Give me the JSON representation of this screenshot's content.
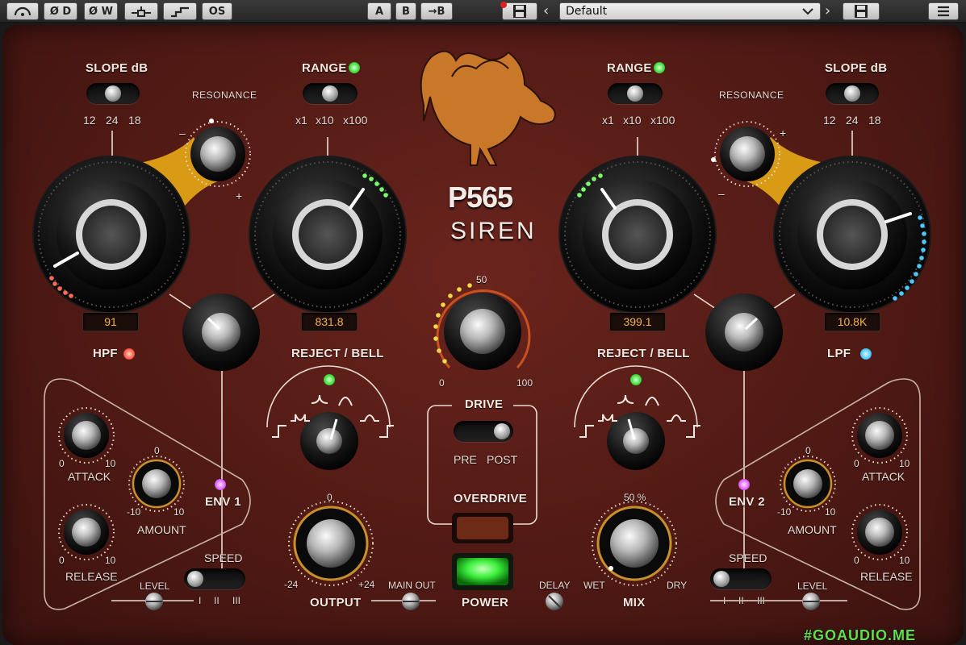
{
  "toolbar": {
    "buttons": [
      "Ø D",
      "Ø W",
      "OS"
    ],
    "ab": {
      "a": "A",
      "b": "B",
      "copy": "→B"
    },
    "preset_name": "Default"
  },
  "brand": {
    "model": "P565",
    "name": "SIREN"
  },
  "left": {
    "slope_title": "SLOPE dB",
    "slope_opts": [
      "12",
      "24",
      "18"
    ],
    "resonance": "RESONANCE",
    "res_minus": "–",
    "res_plus": "+",
    "range_title": "RANGE",
    "range_opts": [
      "x1",
      "x10",
      "x100"
    ],
    "hpf_value": "91",
    "bell_value": "831.8",
    "filter_label": "HPF",
    "reject_bell": "REJECT / BELL",
    "env_label": "ENV 1",
    "attack": "ATTACK",
    "release": "RELEASE",
    "amount": "AMOUNT",
    "speed": "SPEED",
    "level": "LEVEL",
    "speed_opts": [
      "I",
      "II",
      "III"
    ],
    "scale_0": "0",
    "scale_10": "10",
    "scale_m10": "-10"
  },
  "right": {
    "slope_title": "SLOPE dB",
    "slope_opts": [
      "12",
      "24",
      "18"
    ],
    "resonance": "RESONANCE",
    "res_minus": "–",
    "res_plus": "+",
    "range_title": "RANGE",
    "range_opts": [
      "x1",
      "x10",
      "x100"
    ],
    "bell_value": "399.1",
    "lpf_value": "10.8K",
    "filter_label": "LPF",
    "reject_bell": "REJECT / BELL",
    "env_label": "ENV 2",
    "attack": "ATTACK",
    "release": "RELEASE",
    "amount": "AMOUNT",
    "speed": "SPEED",
    "level": "LEVEL",
    "speed_opts": [
      "I",
      "II",
      "III"
    ],
    "scale_0": "0",
    "scale_10": "10",
    "scale_m10": "-10"
  },
  "center": {
    "drive_50": "50",
    "drive_0": "0",
    "drive_100": "100",
    "drive": "DRIVE",
    "pre": "PRE",
    "post": "POST",
    "overdrive": "OVERDRIVE",
    "power": "POWER",
    "output": "OUTPUT",
    "out_0": "0",
    "out_min": "-24",
    "out_max": "+24",
    "main_out": "MAIN OUT",
    "delay": "DELAY",
    "wet": "WET",
    "dry": "DRY",
    "mix": "MIX",
    "mix_pct": "50 %"
  },
  "colors": {
    "panel": "#5a1d17",
    "amber": "#f4b24a",
    "gold": "#e0a21e",
    "green_led": "#5dff5d",
    "cyan_led": "#4cc9ff",
    "red_led": "#ff5a44"
  },
  "watermark": "#GOAUDIO.ME"
}
